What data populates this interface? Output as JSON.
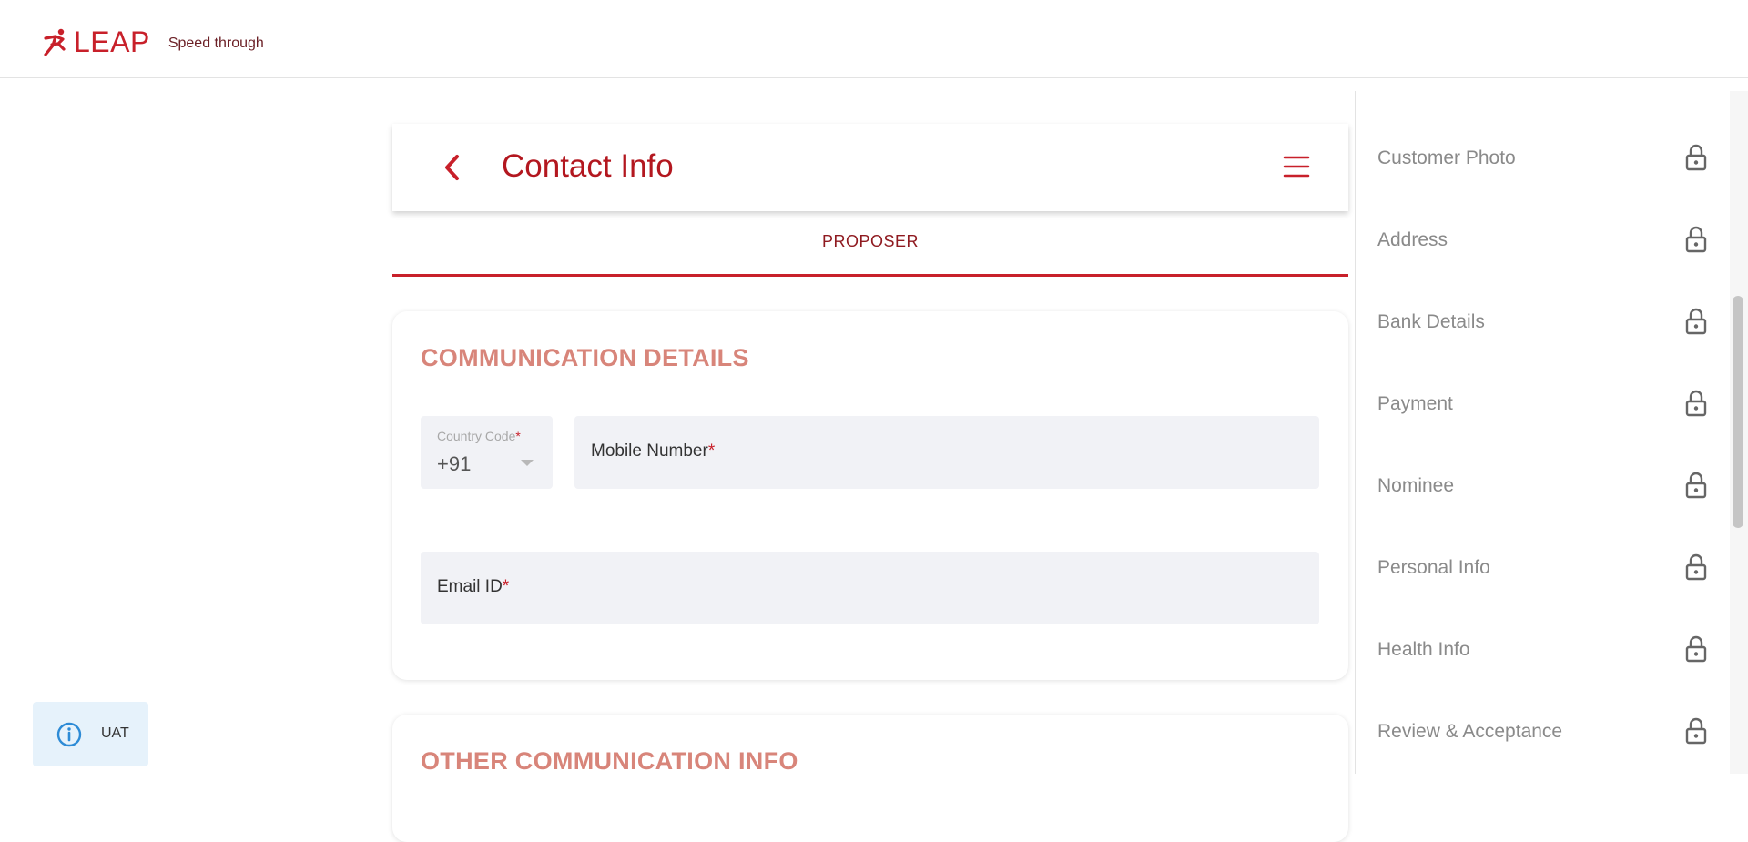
{
  "brand": {
    "name": "LEAP",
    "tagline": "Speed through",
    "color": "#c8202a"
  },
  "header": {
    "title": "Contact Info",
    "back_icon": "chevron-left-icon",
    "menu_icon": "hamburger-menu-icon"
  },
  "tabs": [
    {
      "label": "PROPOSER",
      "active": true
    }
  ],
  "communication_details": {
    "title": "COMMUNICATION DETAILS",
    "country_code": {
      "label": "Country Code",
      "required_mark": "*",
      "value": "+91"
    },
    "mobile_number": {
      "label": "Mobile Number",
      "required_mark": "*",
      "value": ""
    },
    "email_id": {
      "label": "Email ID",
      "required_mark": "*",
      "value": ""
    }
  },
  "other_communication": {
    "title": "OTHER COMMUNICATION INFO"
  },
  "sidebar": {
    "items": [
      {
        "label": "Customer Photo",
        "icon": "lock-icon"
      },
      {
        "label": "Address",
        "icon": "lock-icon"
      },
      {
        "label": "Bank Details",
        "icon": "lock-icon"
      },
      {
        "label": "Payment",
        "icon": "lock-icon"
      },
      {
        "label": "Nominee",
        "icon": "lock-icon"
      },
      {
        "label": "Personal Info",
        "icon": "lock-icon"
      },
      {
        "label": "Health Info",
        "icon": "lock-icon"
      },
      {
        "label": "Review & Acceptance",
        "icon": "lock-icon"
      }
    ]
  },
  "env_badge": {
    "label": "UAT",
    "icon": "info-icon"
  }
}
